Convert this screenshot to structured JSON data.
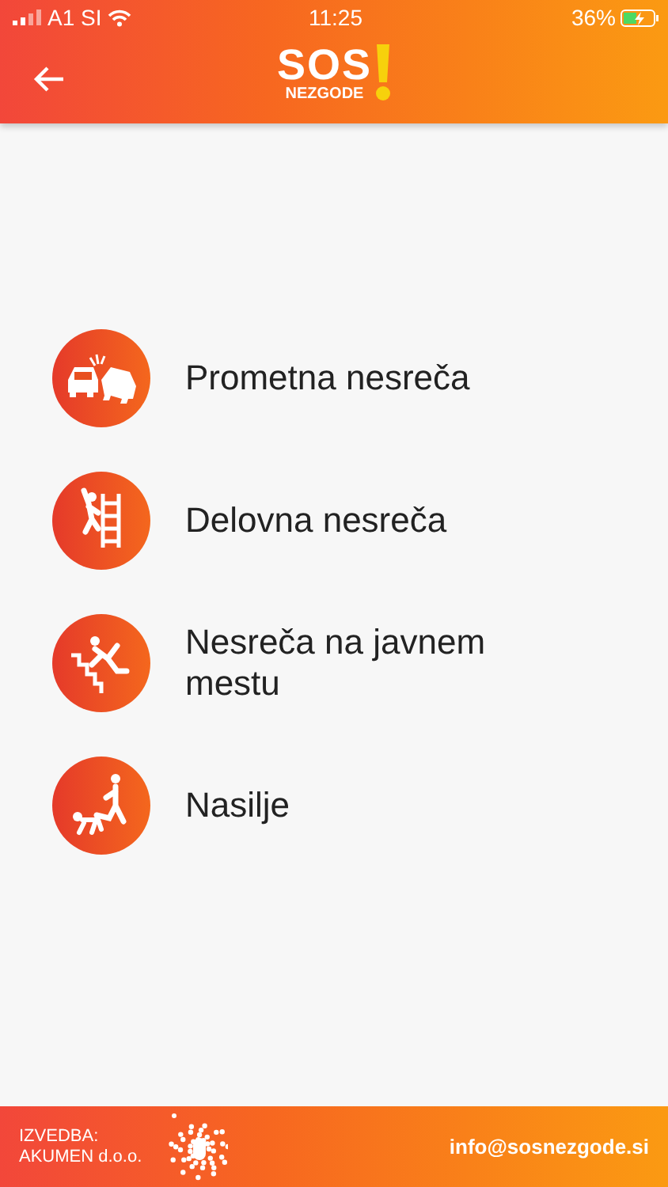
{
  "status_bar": {
    "carrier": "A1 SI",
    "time": "11:25",
    "battery": "36%"
  },
  "header": {
    "logo_top": "SOS",
    "logo_bottom": "NEZGODE"
  },
  "items": [
    {
      "kind": "car-crash",
      "label": "Prometna nesreča"
    },
    {
      "kind": "ladder-fall",
      "label": "Delovna nesreča"
    },
    {
      "kind": "stairs-fall",
      "label": "Nesreča na javnem mestu"
    },
    {
      "kind": "violence",
      "label": "Nasilje"
    }
  ],
  "footer": {
    "credit_lines": [
      "IZVEDBA:",
      "AKUMEN d.o.o."
    ],
    "email": "info@sosnezgode.si"
  }
}
